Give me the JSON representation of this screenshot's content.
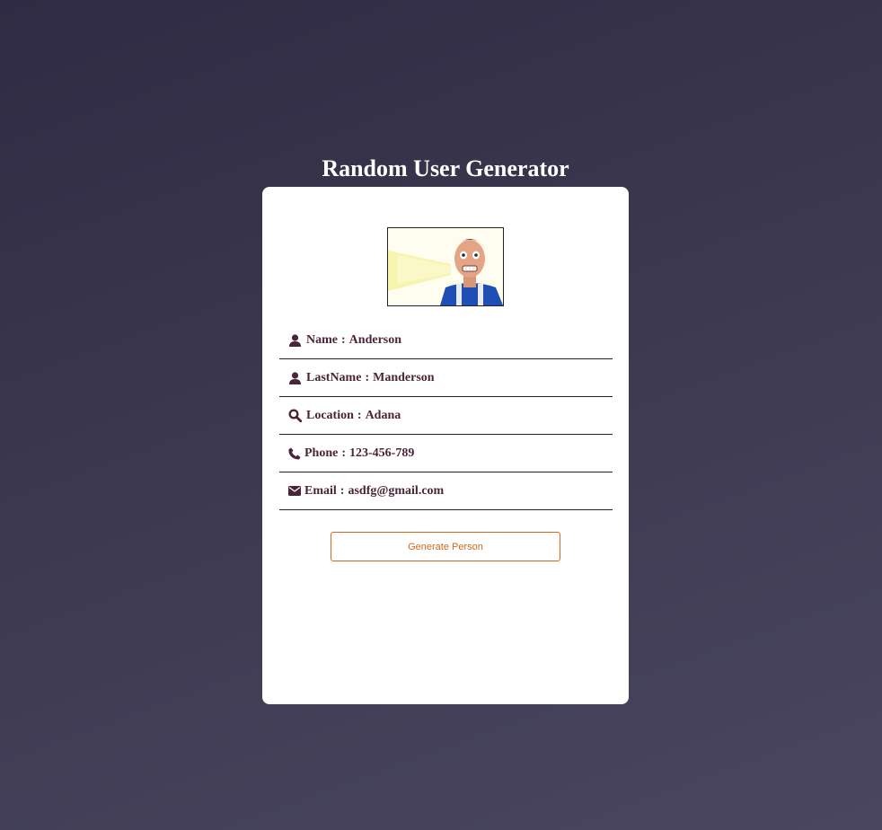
{
  "page": {
    "title": "Random User Generator"
  },
  "profile": {
    "fields": [
      {
        "label": "Name",
        "value": "Anderson",
        "icon": "user-icon"
      },
      {
        "label": "LastName",
        "value": "Manderson",
        "icon": "user-icon"
      },
      {
        "label": "Location",
        "value": "Adana",
        "icon": "search-icon"
      },
      {
        "label": "Phone",
        "value": "123-456-789",
        "icon": "phone-icon"
      },
      {
        "label": "Email",
        "value": "asdfg@gmail.com",
        "icon": "envelope-icon"
      }
    ],
    "separator": ":"
  },
  "actions": {
    "generate_label": "Generate Person"
  },
  "colors": {
    "text_accent": "#4a2538",
    "button_accent": "#d2691e",
    "card_bg": "#ffffff"
  }
}
